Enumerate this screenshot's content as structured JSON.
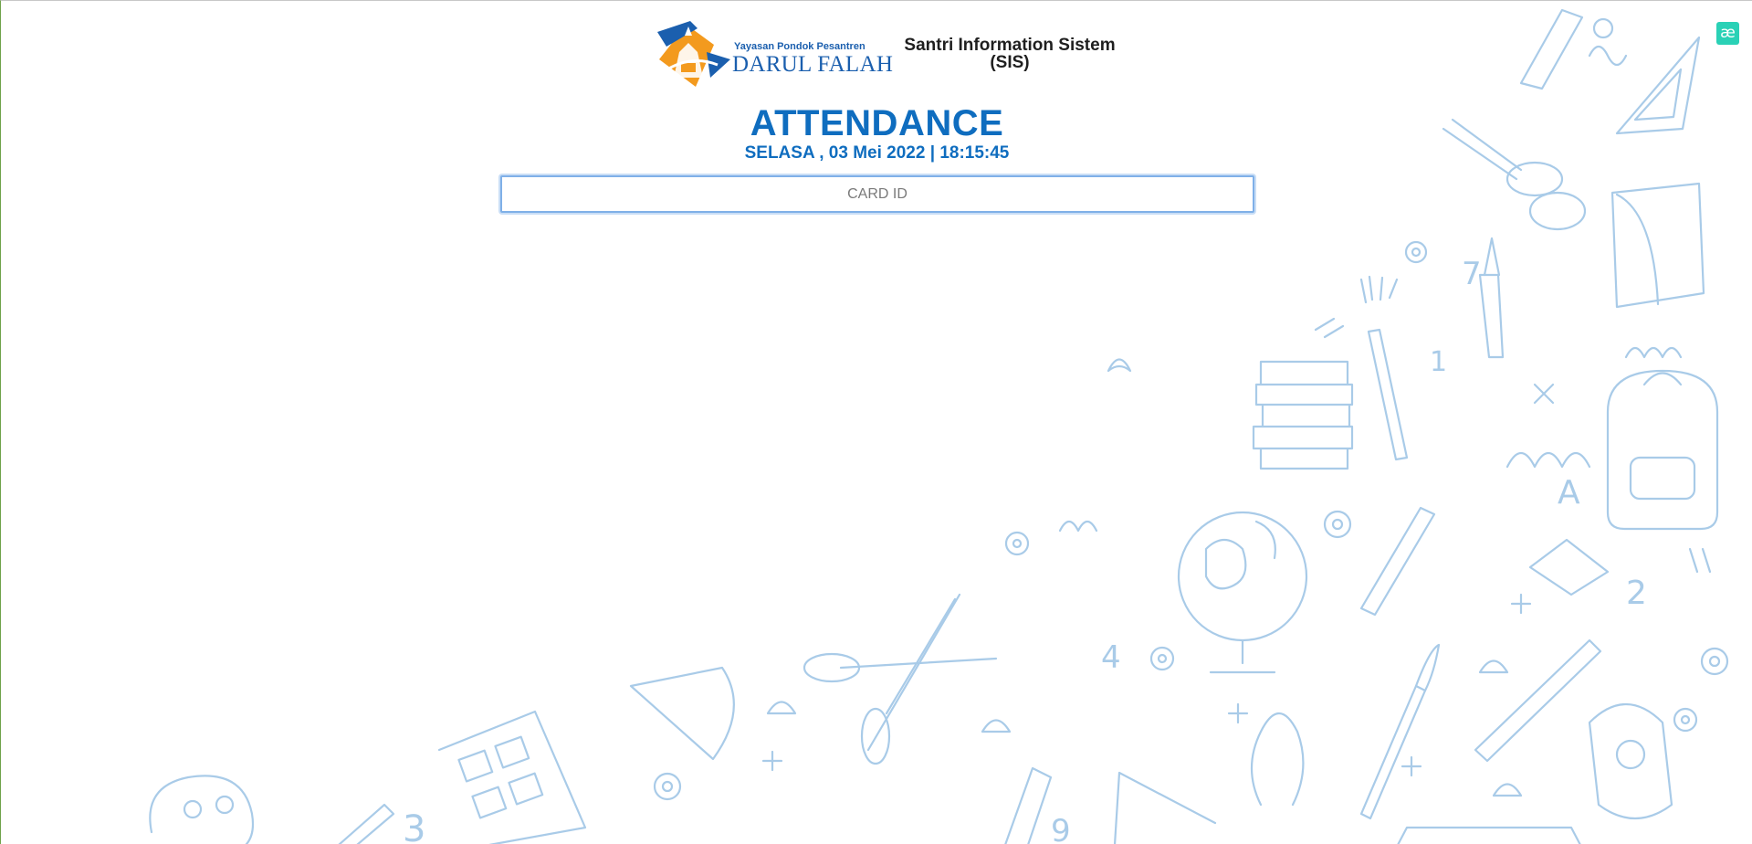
{
  "header": {
    "logo_tagline": "Yayasan Pondok Pesantren",
    "logo_name": "DARUL FALAH",
    "app_title": "Santri Information Sistem",
    "app_subtitle": "(SIS)"
  },
  "main": {
    "title": "ATTENDANCE",
    "datetime": "SELASA , 03 Mei 2022 | 18:15:45",
    "card_input_placeholder": "CARD ID",
    "card_input_value": ""
  },
  "extension": {
    "icon_glyph": "æ",
    "icon_name": "ae-extension-icon"
  },
  "colors": {
    "accent": "#0f6dbf",
    "logo_blue": "#1b5fae",
    "logo_orange": "#f39a1e",
    "doodle": "#a9cbe8",
    "extension": "#2ad1b6"
  }
}
